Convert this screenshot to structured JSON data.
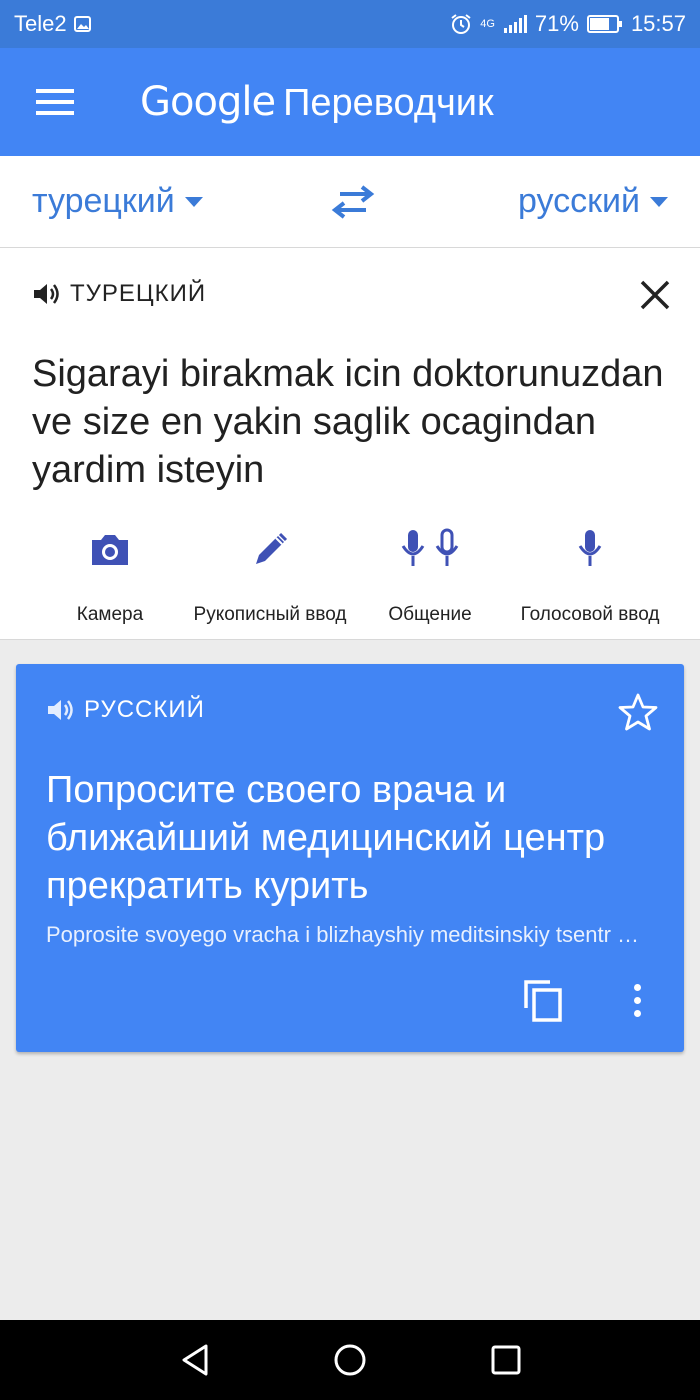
{
  "status_bar": {
    "carrier": "Tele2",
    "network": "4G",
    "battery": "71%",
    "time": "15:57"
  },
  "app_bar": {
    "brand": "Google",
    "product": "Переводчик"
  },
  "language_bar": {
    "source_language": "турецкий",
    "target_language": "русский"
  },
  "input": {
    "language_label": "ТУРЕЦКИЙ",
    "text": "Sigarayi birakmak icin doktorunuzdan ve size en yakin saglik ocagindan yardim isteyin"
  },
  "tools": [
    {
      "label": "Камера",
      "icon": "camera-icon"
    },
    {
      "label": "Рукописный ввод",
      "icon": "pen-icon"
    },
    {
      "label": "Общение",
      "icon": "conversation-mic-icon"
    },
    {
      "label": "Голосовой ввод",
      "icon": "mic-icon"
    }
  ],
  "result": {
    "language_label": "РУССКИЙ",
    "text": "Попросите своего врача и ближайший медицинский центр прекратить курить",
    "transliteration": "Poprosite svoyego vracha i blizhayshiy meditsinskiy tsentr prekratit' kurit'"
  },
  "colors": {
    "primary": "#4285f4",
    "status": "#3b7bd8",
    "tool_icon": "#3f51b5"
  }
}
